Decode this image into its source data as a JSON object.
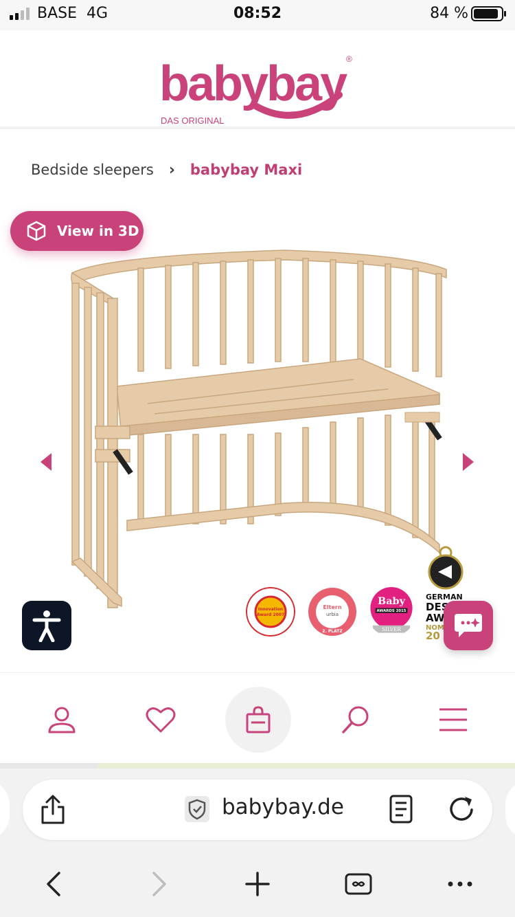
{
  "status_bar": {
    "carrier": "BASE",
    "network": "4G",
    "time": "08:52",
    "battery": "84 %"
  },
  "header": {
    "logo_text": "babybay",
    "logo_tagline": "DAS ORIGINAL",
    "logo_registered": "®"
  },
  "breadcrumb": {
    "parent": "Bedside sleepers",
    "current": "babybay Maxi"
  },
  "product": {
    "view_3d_label": "View in 3D",
    "awards": [
      {
        "name": "kind-jugend-innovation-award",
        "text": "Innovation Award 2007"
      },
      {
        "name": "eltern-consumer-award",
        "text": "Eltern urbia 2. PLATZ"
      },
      {
        "name": "baby-awards-silver",
        "text": "Baby AWARDS 2015 SILVER"
      },
      {
        "name": "german-design-award",
        "text": "GERMAN DESIGN AWARD NOMINEE 20"
      }
    ]
  },
  "bottom_nav": {
    "items": [
      "account-icon",
      "wishlist-icon",
      "cart-icon",
      "search-icon",
      "menu-icon"
    ]
  },
  "browser": {
    "url": "babybay.de"
  },
  "colors": {
    "brand": "#c9437a",
    "brand_dark": "#bf3e73",
    "a11y": "#0d1626"
  }
}
